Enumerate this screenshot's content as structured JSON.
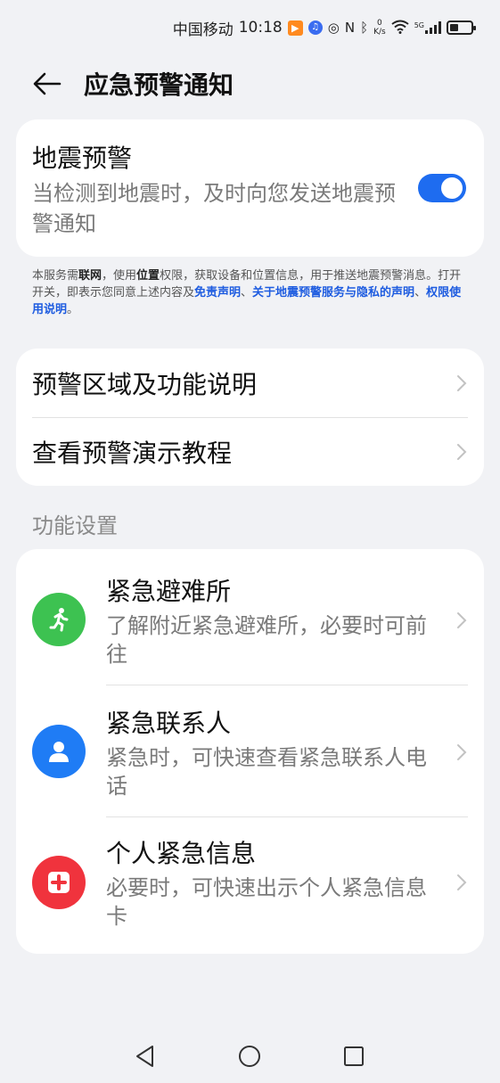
{
  "status_bar": {
    "carrier": "中国移动",
    "time": "10:18",
    "speed_value": "0",
    "speed_unit": "K/s",
    "network": "5G"
  },
  "header": {
    "title": "应急预警通知"
  },
  "earthquake": {
    "title": "地震预警",
    "description": "当检测到地震时，及时向您发送地震预警通知",
    "toggle_on": true,
    "accent_color": "#1e6cf0"
  },
  "notice": {
    "p1": "本服务需",
    "b1": "联网",
    "p2": "，使用",
    "b2": "位置",
    "p3": "权限，获取设备和位置信息，用于推送地震预警消息。打开开关，即表示您同意上述内容及",
    "l1": "免责声明",
    "p4": "、",
    "l2": "关于地震预警服务与隐私的声明",
    "p5": "、",
    "l3": "权限使用说明",
    "p6": "。"
  },
  "links": [
    {
      "label": "预警区域及功能说明"
    },
    {
      "label": "查看预警演示教程"
    }
  ],
  "section": {
    "title": "功能设置"
  },
  "functions": [
    {
      "title": "紧急避难所",
      "desc": "了解附近紧急避难所，必要时可前往",
      "icon": "running-person-icon",
      "color": "#3dc251"
    },
    {
      "title": "紧急联系人",
      "desc": "紧急时，可快速查看紧急联系人电话",
      "icon": "person-icon",
      "color": "#1f7cf5"
    },
    {
      "title": "个人紧急信息",
      "desc": "必要时，可快速出示个人紧急信息卡",
      "icon": "medical-card-icon",
      "color": "#f0333d"
    }
  ],
  "nav": {
    "back": "back-nav-icon",
    "home": "home-nav-icon",
    "recents": "recents-nav-icon"
  }
}
